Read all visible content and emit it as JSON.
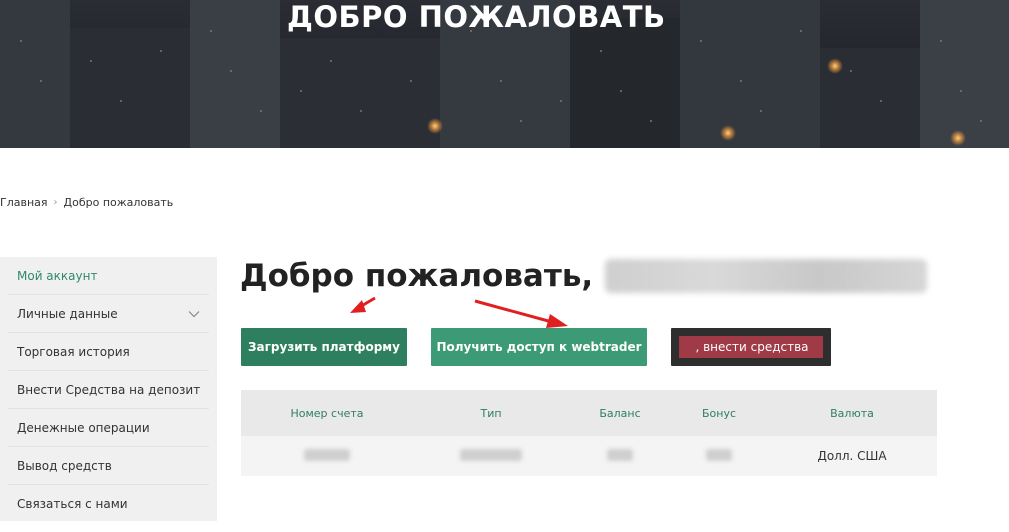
{
  "hero": {
    "title": "ДОБРО ПОЖАЛОВАТЬ"
  },
  "breadcrumb": {
    "home": "Главная",
    "separator": "›",
    "current": "Добро пожаловать"
  },
  "sidebar": {
    "items": [
      {
        "label": "Мой аккаунт",
        "active": true
      },
      {
        "label": "Личные данные",
        "has_dropdown": true
      },
      {
        "label": "Торговая история"
      },
      {
        "label": "Внести Средства на депозит"
      },
      {
        "label": "Денежные операции"
      },
      {
        "label": "Вывод средств"
      },
      {
        "label": "Связаться с нами"
      }
    ]
  },
  "main": {
    "welcome": "Добро пожаловать,",
    "buttons": {
      "upload": "Загрузить платформу",
      "webtrader": "Получить доступ к webtrader",
      "deposit": ", внести средства"
    },
    "table": {
      "headers": [
        "Номер счета",
        "Тип",
        "Баланс",
        "Бонус",
        "Валюта"
      ],
      "rows": [
        [
          "",
          "",
          "",
          "",
          "Долл. США"
        ]
      ]
    }
  },
  "colors": {
    "accent": "#2d7f5f",
    "accent_light": "#3c9a76",
    "annotation_arrow": "#e02020"
  }
}
